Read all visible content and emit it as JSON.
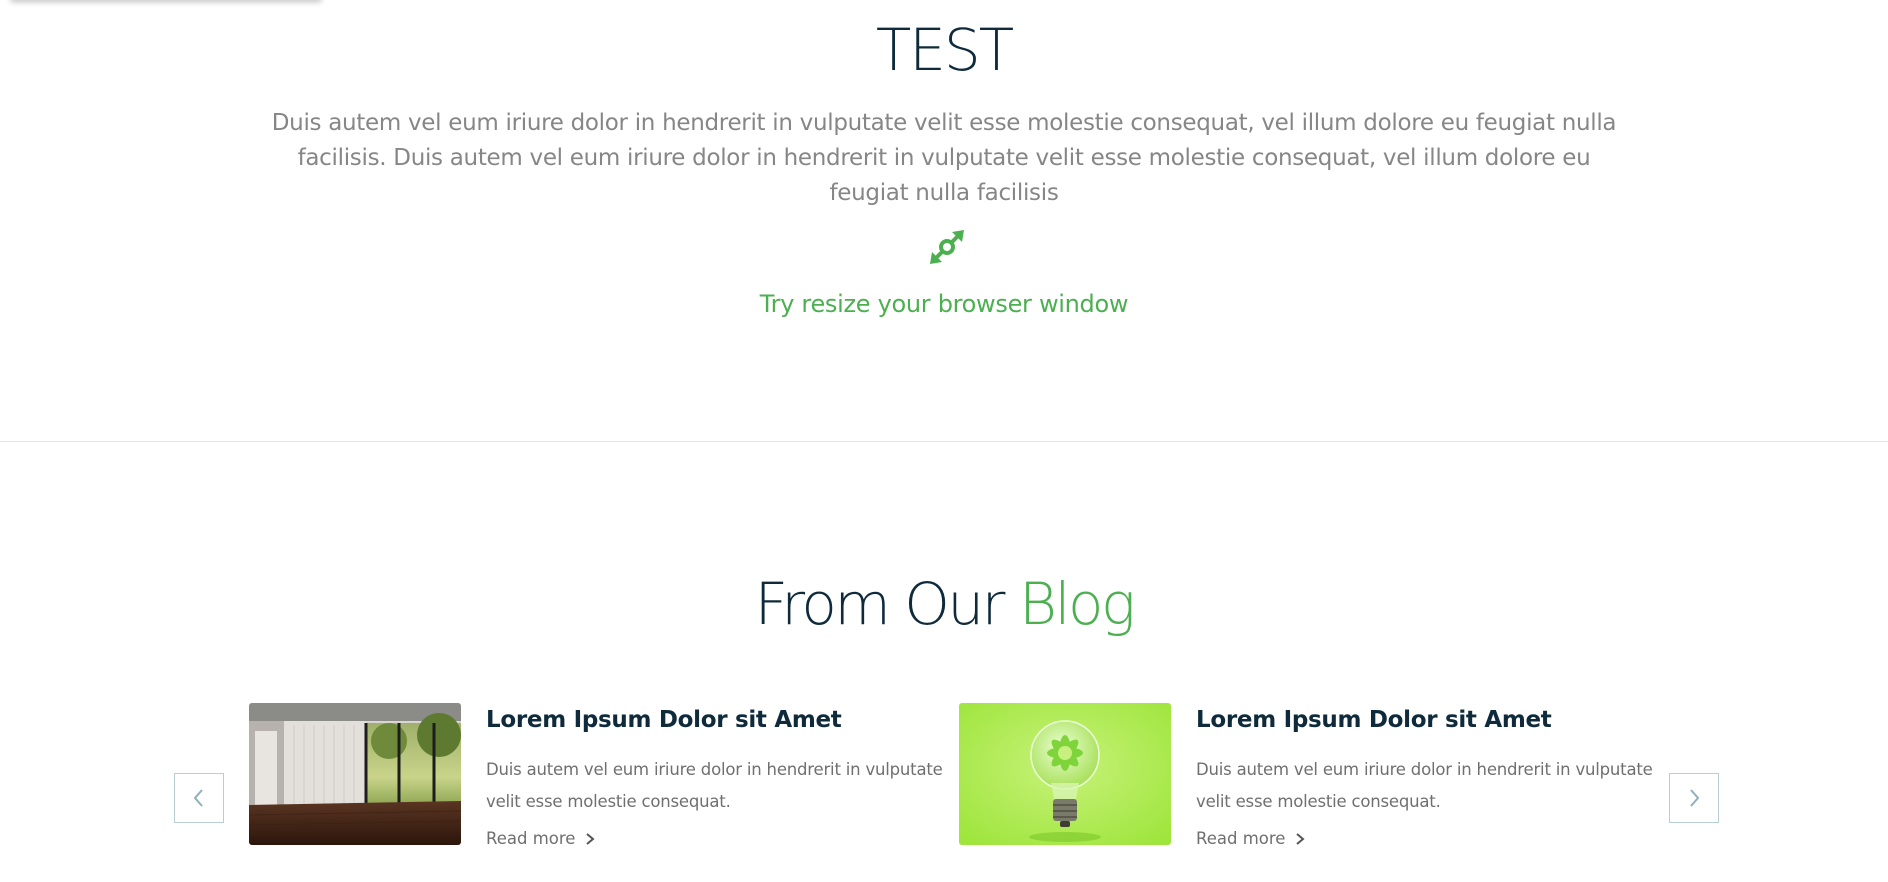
{
  "hero": {
    "title": "TEST",
    "text": "Duis autem vel eum iriure dolor in hendrerit in vulputate velit esse molestie consequat, vel illum dolore eu feugiat nulla facilisis. Duis autem vel eum iriure dolor in hendrerit in vulputate velit esse molestie consequat, vel illum dolore eu feugiat nulla facilisis",
    "icon": "resize-arrows-icon",
    "hint": "Try resize your browser window"
  },
  "blog": {
    "heading_part1": "From Our ",
    "heading_part2": "Blog",
    "prev_icon": "chevron-left-icon",
    "next_icon": "chevron-right-icon",
    "posts": [
      {
        "title": "Lorem Ipsum Dolor sit Amet",
        "excerpt": "Duis autem vel eum iriure dolor in hendrerit in vulputate velit esse molestie consequat.",
        "read_more": "Read more",
        "image": "interior-room-photo"
      },
      {
        "title": "Lorem Ipsum Dolor sit Amet",
        "excerpt": "Duis autem vel eum iriure dolor in hendrerit in vulputate velit esse molestie consequat.",
        "read_more": "Read more",
        "image": "green-lightbulb-photo"
      }
    ]
  },
  "colors": {
    "heading": "#0e2a3b",
    "accent": "#4caf50",
    "body_text": "#868686",
    "border": "#b9cfd6"
  }
}
